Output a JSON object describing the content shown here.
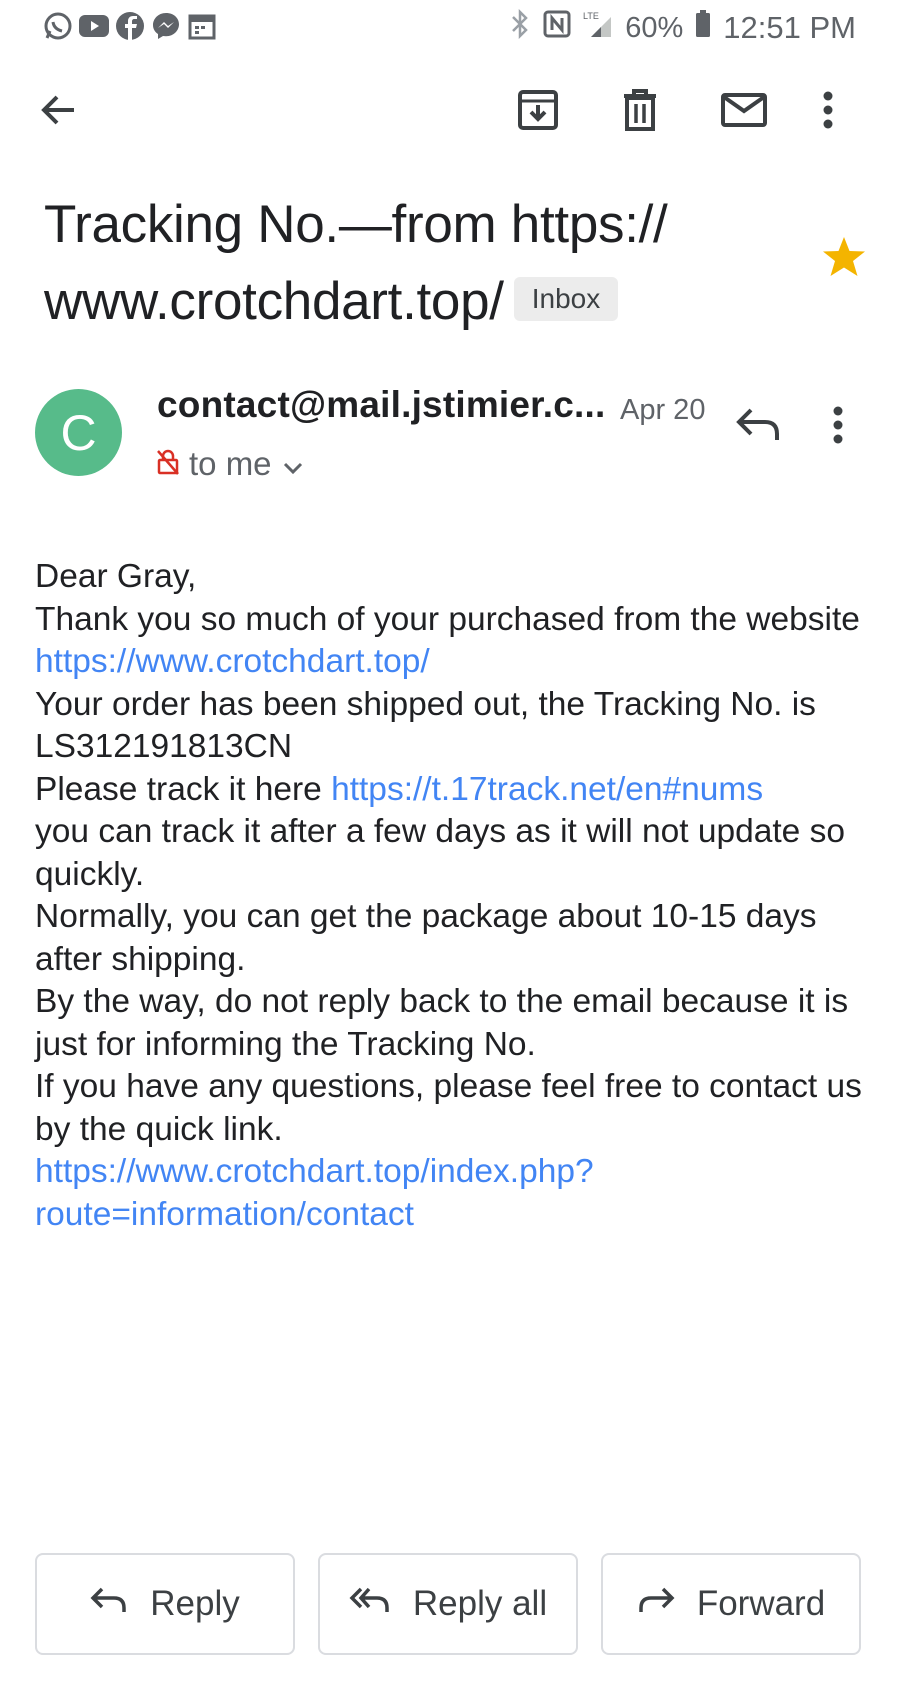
{
  "status_bar": {
    "left_icons": [
      "whatsapp-icon",
      "youtube-icon",
      "facebook-icon",
      "messenger-icon",
      "calendar-icon"
    ],
    "right_icons": [
      "bluetooth-icon",
      "nfc-icon",
      "lte-signal-icon",
      "battery-icon"
    ],
    "battery_percent": "60%",
    "time": "12:51 PM"
  },
  "toolbar": {
    "buttons": [
      "back-arrow-icon",
      "archive-icon",
      "delete-icon",
      "mark-unread-icon",
      "more-vert-icon"
    ]
  },
  "email": {
    "subject": "Tracking No.—from https:// www.crotchdart.top/",
    "label": "Inbox",
    "starred": true,
    "star_color": "#f4b400"
  },
  "sender": {
    "avatar_letter": "C",
    "avatar_color": "#57bb8a",
    "name": "contact@mail.jstimier.c...",
    "date": "Apr 20",
    "recipient": "to me"
  },
  "body": {
    "greeting": "Dear Gray,",
    "line1_a": "Thank you so much of your purchased from the website ",
    "line1_link": "https://www.crotchdart.top/",
    "line2": "Your order has been shipped out, the Tracking No. is LS312191813CN",
    "line3_a": "Please track it here ",
    "line3_link": "https://t.17track.net/en#nums",
    "line4": "you can track it after a few days as it will not update so quickly.",
    "line5": "Normally, you can get the package about 10-15 days after shipping.",
    "line6": "By the way, do not reply back to the email because it is just for informing the Tracking No.",
    "line7": "If you have any questions, please feel free to contact us by the quick link.",
    "line8_link": "https://www.crotchdart.top/index.php?route=information/contact",
    "link_color": "#4285f4"
  },
  "actions": {
    "reply": "Reply",
    "reply_all": "Reply all",
    "forward": "Forward"
  }
}
